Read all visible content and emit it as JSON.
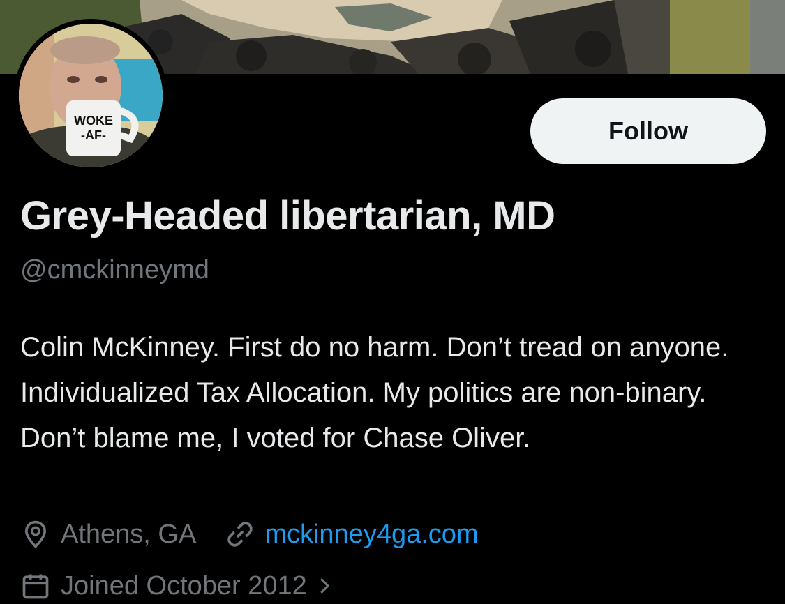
{
  "profile": {
    "display_name": "Grey-Headed libertarian, MD",
    "handle": "@cmckinneymd",
    "bio": "Colin McKinney. First do no harm. Don’t tread on anyone. Individualized Tax Allocation. My politics are non-binary. Don’t blame me, I voted for Chase Oliver.",
    "location": "Athens, GA",
    "website": "mckinney4ga.com",
    "joined": "Joined October 2012",
    "avatar_mug_text": "WOKE -AF-"
  },
  "actions": {
    "follow_label": "Follow"
  },
  "icons": {
    "location": "location-pin-icon",
    "website": "link-icon",
    "joined": "calendar-icon",
    "joined_chevron": "chevron-right-icon"
  },
  "colors": {
    "background": "#000000",
    "primary_text": "#e7e9ea",
    "secondary_text": "#71767b",
    "link": "#1d9bf0",
    "follow_button_bg": "#eff3f4",
    "follow_button_text": "#0f1419"
  }
}
